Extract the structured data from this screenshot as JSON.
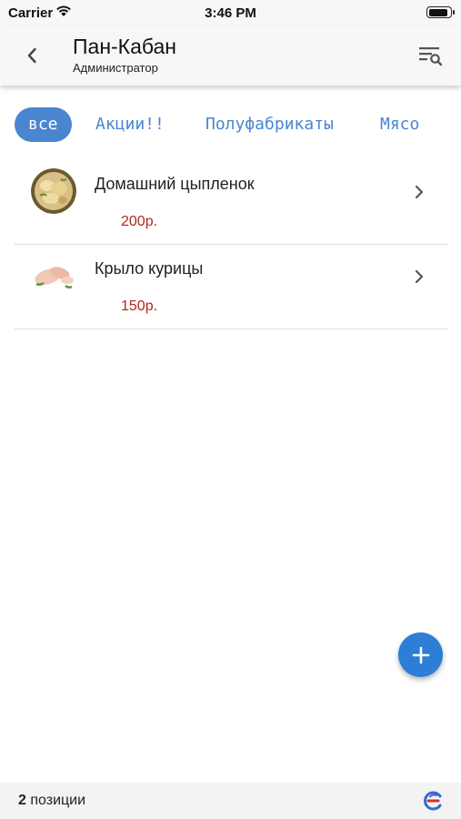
{
  "status_bar": {
    "carrier": "Carrier",
    "time": "3:46 PM",
    "battery_level": 0.9
  },
  "header": {
    "title": "Пан-Кабан",
    "subtitle": "Администратор",
    "back_icon": "chevron-left-icon",
    "filter_icon": "filter-search-icon"
  },
  "tabs": [
    {
      "label": "все",
      "active": true
    },
    {
      "label": "Акции!!",
      "active": false
    },
    {
      "label": "Полуфабрикаты",
      "active": false
    },
    {
      "label": "Мясо",
      "active": false
    }
  ],
  "products": [
    {
      "name": "Домашний цыпленок",
      "price": "200р.",
      "image": "cooked-chicken-photo"
    },
    {
      "name": "Крыло курицы",
      "price": "150р.",
      "image": "raw-chicken-wing-photo"
    }
  ],
  "fab": {
    "icon": "plus-icon"
  },
  "footer": {
    "count": "2",
    "count_label": "позиции",
    "logo_icon": "app-logo-icon"
  },
  "colors": {
    "accent": "#4a86d0",
    "fab": "#2d7ed6",
    "price": "#b1261f"
  }
}
